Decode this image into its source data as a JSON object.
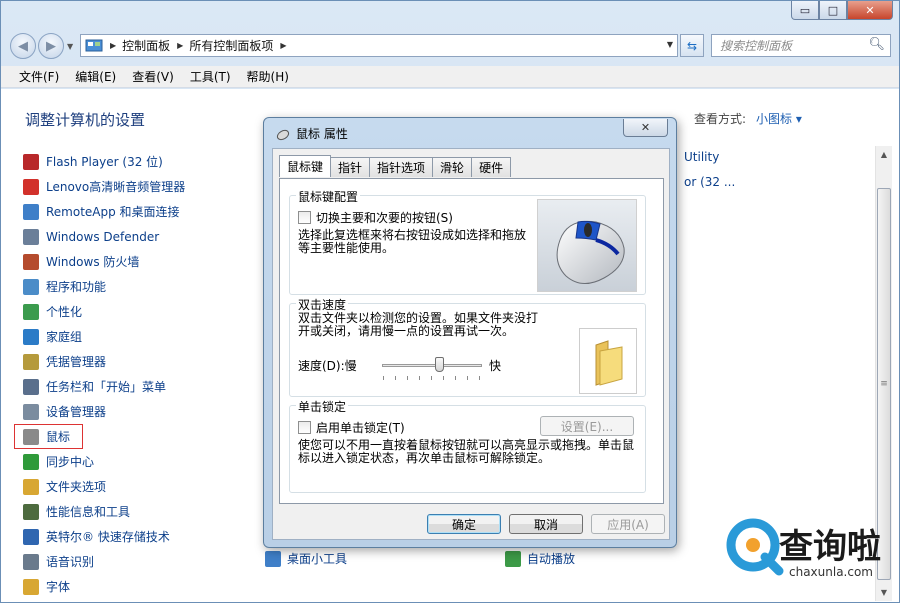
{
  "window": {
    "caption_buttons": {
      "minimize": "▭",
      "maximize": "□",
      "close": "✕"
    }
  },
  "address": {
    "crumbs": [
      "控制面板",
      "所有控制面板项"
    ],
    "search_placeholder": "搜索控制面板"
  },
  "menubar": [
    "文件(F)",
    "编辑(E)",
    "查看(V)",
    "工具(T)",
    "帮助(H)"
  ],
  "main": {
    "heading": "调整计算机的设置",
    "view_by_label": "查看方式:",
    "view_by_value": "小图标 ▾",
    "items": [
      {
        "label": "Flash Player (32 位)",
        "icon": "flash-icon",
        "color": "#b8282a"
      },
      {
        "label": "Lenovo高清晰音频管理器",
        "icon": "audio-icon",
        "color": "#d2312b"
      },
      {
        "label": "RemoteApp 和桌面连接",
        "icon": "remoteapp-icon",
        "color": "#3f7fc8"
      },
      {
        "label": "Windows Defender",
        "icon": "defender-icon",
        "color": "#6b7f99"
      },
      {
        "label": "Windows 防火墙",
        "icon": "firewall-icon",
        "color": "#b54b2d"
      },
      {
        "label": "程序和功能",
        "icon": "programs-icon",
        "color": "#4b8cc8"
      },
      {
        "label": "个性化",
        "icon": "personalize-icon",
        "color": "#3b9b4d"
      },
      {
        "label": "家庭组",
        "icon": "homegroup-icon",
        "color": "#2b7bc7"
      },
      {
        "label": "凭据管理器",
        "icon": "credential-icon",
        "color": "#b59a3c"
      },
      {
        "label": "任务栏和「开始」菜单",
        "icon": "taskbar-icon",
        "color": "#5a6f8c"
      },
      {
        "label": "设备管理器",
        "icon": "device-manager-icon",
        "color": "#7b8c9f"
      },
      {
        "label": "鼠标",
        "icon": "mouse-icon",
        "color": "#8a8a8a"
      },
      {
        "label": "同步中心",
        "icon": "sync-icon",
        "color": "#2f9a3a"
      },
      {
        "label": "文件夹选项",
        "icon": "folder-options-icon",
        "color": "#d8a733"
      },
      {
        "label": "性能信息和工具",
        "icon": "performance-icon",
        "color": "#4d6b3f"
      },
      {
        "label": "英特尔® 快速存储技术",
        "icon": "intel-icon",
        "color": "#2f66b0"
      },
      {
        "label": "语音识别",
        "icon": "microphone-icon",
        "color": "#6a7a8c"
      },
      {
        "label": "字体",
        "icon": "font-icon",
        "color": "#d8a733"
      }
    ],
    "col2_bottom": "桌面小工具",
    "col3_bottom": "自动播放",
    "right_text_1": "Utility",
    "right_text_2": "or (32 ..."
  },
  "dialog": {
    "title": "鼠标 属性",
    "close": "✕",
    "tabs": [
      "鼠标键",
      "指针",
      "指针选项",
      "滑轮",
      "硬件"
    ],
    "button_config": {
      "title": "鼠标键配置",
      "checkbox_label": "切换主要和次要的按钮(S)",
      "description": "选择此复选框来将右按钮设成如选择和拖放等主要性能使用。"
    },
    "double_click": {
      "title": "双击速度",
      "description": "双击文件夹以检测您的设置。如果文件夹没打开或关闭，请用慢一点的设置再试一次。",
      "speed_label": "速度(D):",
      "slow": "慢",
      "fast": "快"
    },
    "click_lock": {
      "title": "单击锁定",
      "checkbox_label": "启用单击锁定(T)",
      "settings_button": "设置(E)...",
      "description": "使您可以不用一直按着鼠标按钮就可以高亮显示或拖拽。单击鼠标以进入锁定状态，再次单击鼠标可解除锁定。"
    },
    "ok": "确定",
    "cancel": "取消",
    "apply": "应用(A)"
  },
  "watermark": {
    "text": "查询啦",
    "url": "chaxunla.com"
  }
}
